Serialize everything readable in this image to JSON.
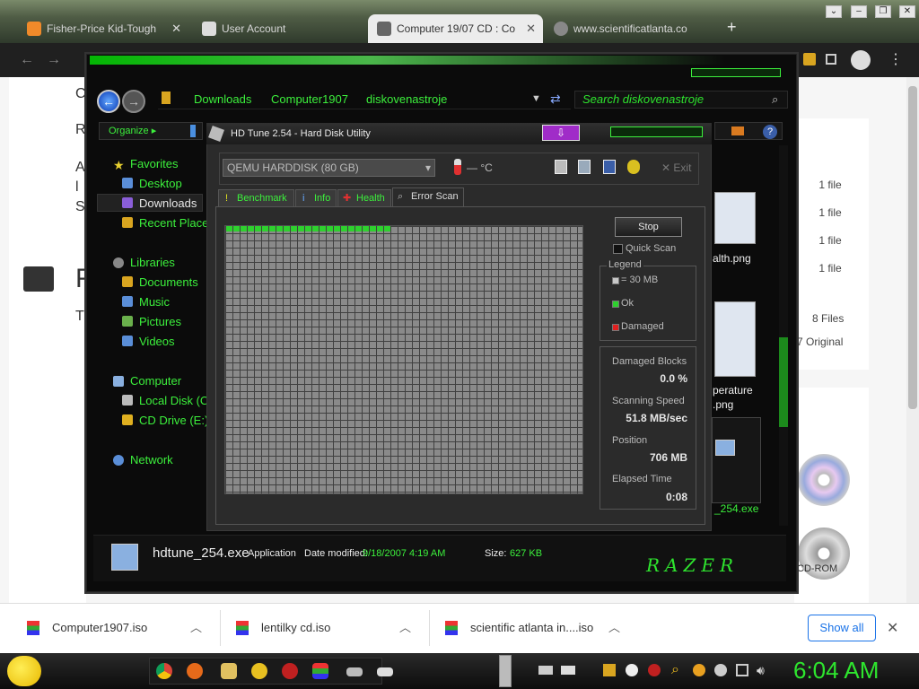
{
  "browser": {
    "tabs": [
      {
        "label": "Fisher-Price Kid-Tough",
        "active": false
      },
      {
        "label": "User Account",
        "active": false
      },
      {
        "label": "Computer 19/07 CD : Co",
        "active": true
      },
      {
        "label": "www.scientificatlanta.co",
        "active": false
      }
    ],
    "new_tab": "+",
    "page_texts": {
      "files": [
        "1 file",
        "1 file",
        "1 file",
        "1 file"
      ],
      "eight_files": "8 Files",
      "original": "7 Original"
    }
  },
  "explorer": {
    "breadcrumb": [
      "Downloads",
      "Computer1907",
      "diskovenastroje"
    ],
    "search_placeholder": "Search diskovenastroje",
    "organize": "Organize",
    "nav": {
      "favorites": "Favorites",
      "desktop": "Desktop",
      "downloads": "Downloads",
      "recent": "Recent Place",
      "libraries": "Libraries",
      "documents": "Documents",
      "music": "Music",
      "pictures": "Pictures",
      "videos": "Videos",
      "computer": "Computer",
      "local_disk": "Local Disk (C",
      "cd_drive": "CD Drive (E:)",
      "network": "Network"
    },
    "files": {
      "health_png": "alth.png",
      "temperature_png": "perature",
      "temperature_png2": ".png",
      "exe": "_254.exe",
      "cdrom": "CD-ROM"
    },
    "status": {
      "name": "hdtune_254.exe",
      "type": "Application",
      "date_label": "Date modified:",
      "date_value": "9/18/2007 4:19 AM",
      "size_label": "Size:",
      "size_value": "627 KB",
      "logo": "RAZER"
    }
  },
  "hdtune": {
    "title": "HD Tune 2.54 - Hard Disk Utility",
    "drive": "QEMU HARDDISK (80 GB)",
    "temperature": "— °C",
    "exit": "Exit",
    "tabs": [
      "Benchmark",
      "Info",
      "Health",
      "Error Scan"
    ],
    "active_tab": "Error Scan",
    "stop": "Stop",
    "quick_scan": "Quick Scan",
    "legend_title": "Legend",
    "legend": [
      "= 30 MB",
      "Ok",
      "Damaged"
    ],
    "legend_colors": [
      "#c8c8c8",
      "#2ed12e",
      "#e02020"
    ],
    "stats": {
      "damaged_label": "Damaged Blocks",
      "damaged_value": "0.0 %",
      "speed_label": "Scanning Speed",
      "speed_value": "51.8 MB/sec",
      "position_label": "Position",
      "position_value": "706 MB",
      "elapsed_label": "Elapsed Time",
      "elapsed_value": "0:08"
    }
  },
  "downloads": {
    "items": [
      "Computer1907.iso",
      "lentilky cd.iso",
      "scientific atlanta in....iso"
    ],
    "show_all": "Show all",
    "close": "✕"
  },
  "taskbar": {
    "clock": "6:04 AM"
  }
}
